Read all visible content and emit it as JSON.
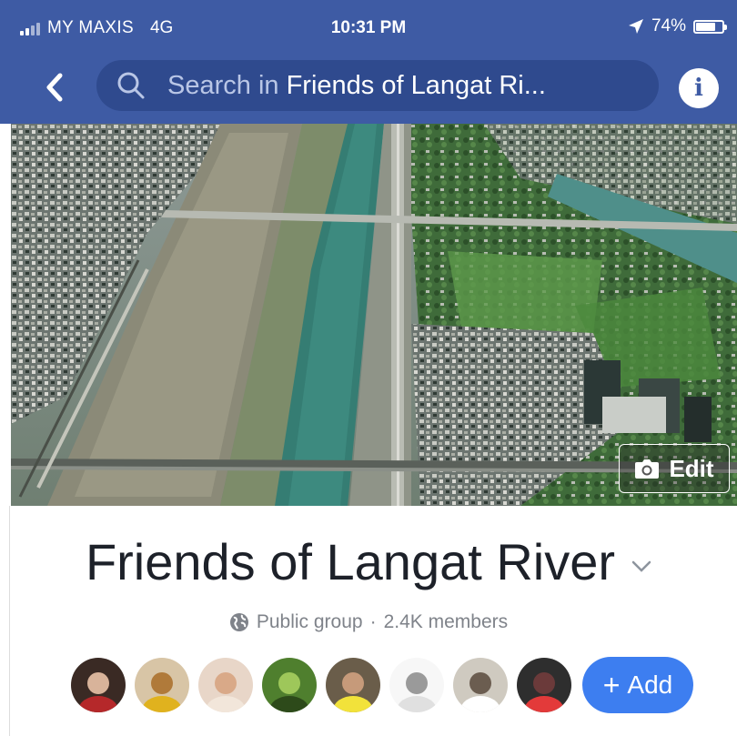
{
  "status_bar": {
    "carrier": "MY MAXIS",
    "network": "4G",
    "time": "10:31 PM",
    "battery": "74%",
    "battery_level": 0.74
  },
  "header": {
    "search_prefix": "Search in",
    "search_group": "Friends of Langat Ri..."
  },
  "cover": {
    "edit_label": "Edit"
  },
  "group": {
    "name": "Friends of Langat River",
    "privacy": "Public group",
    "separator": "·",
    "members": "2.4K members"
  },
  "member_avatars": [
    {
      "bg": "#3a2a24",
      "fg": "#d8b39a",
      "accent": "#b5282a"
    },
    {
      "bg": "#d8c5a6",
      "fg": "#b07a3a",
      "accent": "#e0b21e"
    },
    {
      "bg": "#e8d6c8",
      "fg": "#d9a988",
      "accent": "#f2e6da"
    },
    {
      "bg": "#4f7f2e",
      "fg": "#9ec75a",
      "accent": "#2d4a1a"
    },
    {
      "bg": "#6a5d4a",
      "fg": "#c69a7a",
      "accent": "#f2e23a"
    },
    {
      "bg": "#f7f7f7",
      "fg": "#9a9a9a",
      "accent": "#e0e0e0"
    },
    {
      "bg": "#cfcac0",
      "fg": "#6b5d50",
      "accent": "#ffffff"
    },
    {
      "bg": "#2e2e2e",
      "fg": "#6b3a3a",
      "accent": "#e33a3a"
    }
  ],
  "add_button": {
    "label": "Add"
  },
  "colors": {
    "header_blue": "#3e5ba4",
    "add_blue": "#3d7ef0"
  }
}
